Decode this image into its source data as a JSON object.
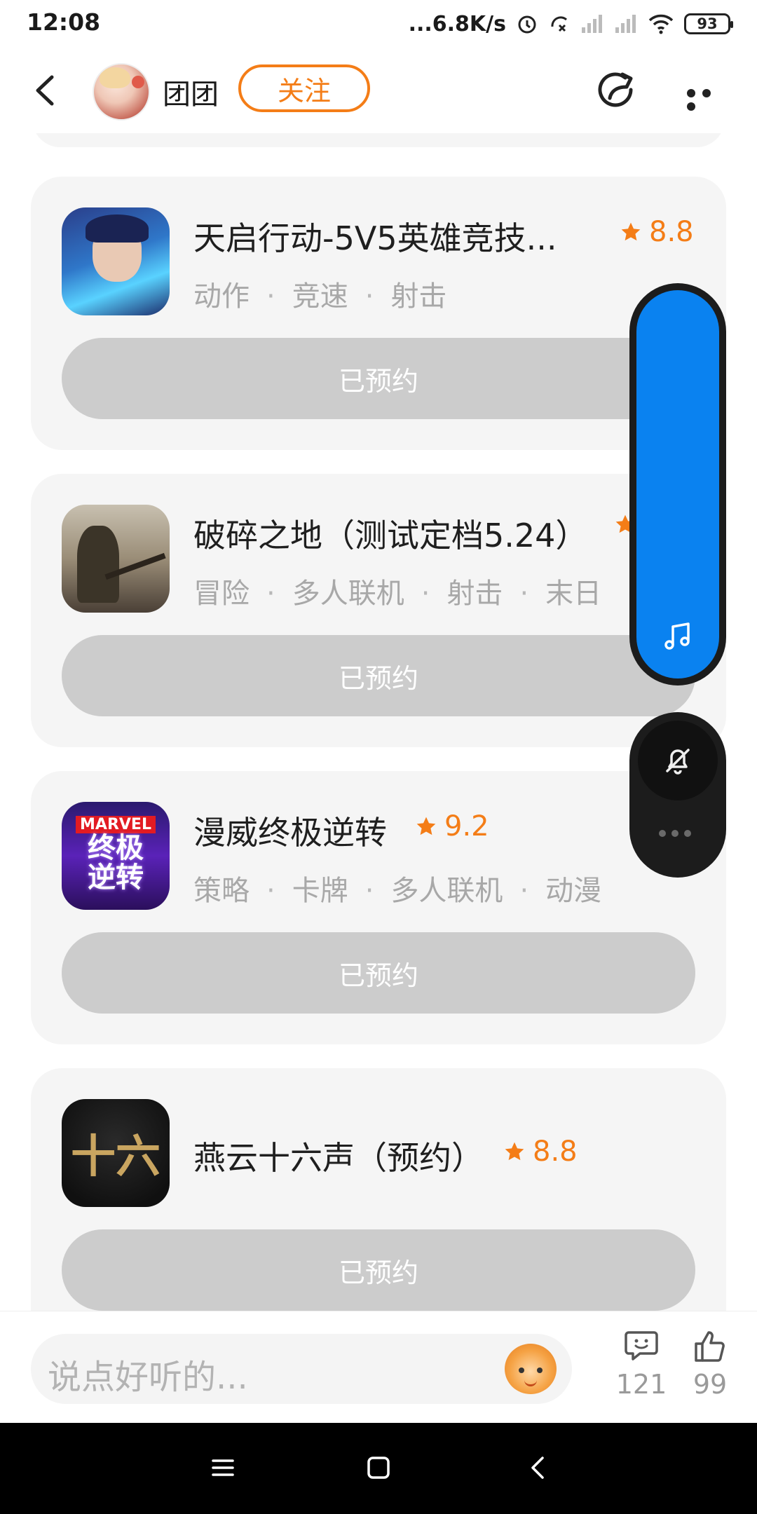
{
  "status_bar": {
    "time": "12:08",
    "net_speed": "...6.8K/s",
    "battery": "93",
    "icons": [
      "alarm-icon",
      "no-data-icon",
      "signal-icon",
      "signal-icon",
      "wifi-icon",
      "battery-icon"
    ]
  },
  "header": {
    "username": "团团",
    "follow_label": "关注",
    "icons": [
      "back-arrow-icon",
      "share-icon",
      "more-icon"
    ]
  },
  "games": [
    {
      "title": "天启行动-5V5英雄竞技...",
      "rating": "8.8",
      "tags": [
        "动作",
        "竞速",
        "射击"
      ],
      "button": "已预约"
    },
    {
      "title": "破碎之地（测试定档5.24）",
      "rating": "",
      "tags": [
        "冒险",
        "多人联机",
        "射击",
        "末日"
      ],
      "button": "已预约"
    },
    {
      "title": "漫威终极逆转",
      "rating": "9.2",
      "tags": [
        "策略",
        "卡牌",
        "多人联机",
        "动漫"
      ],
      "button": "已预约",
      "icon_text_top": "MARVEL",
      "icon_text_main": "终极逆转"
    },
    {
      "title": "燕云十六声（预约）",
      "rating": "8.8",
      "tags": [],
      "button": "已预约",
      "icon_text_main": "十六"
    }
  ],
  "floating": {
    "icons": [
      "music-note-icon",
      "bell-off-icon",
      "more-dots-icon"
    ]
  },
  "comment_bar": {
    "placeholder": "说点好听的...",
    "comment_count": "121",
    "like_count": "99"
  },
  "colors": {
    "accent": "#f47d17",
    "card_bg": "#f5f5f5",
    "reserved_btn": "#cccccc",
    "float_blue": "#0a82f0"
  }
}
